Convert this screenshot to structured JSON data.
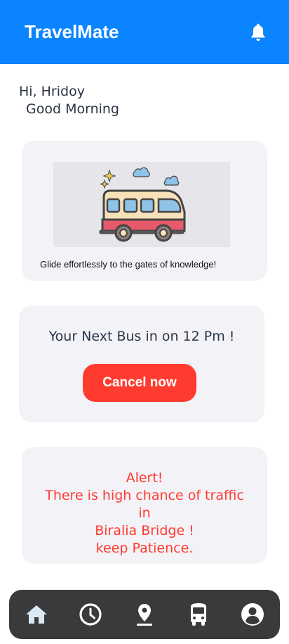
{
  "header": {
    "title": "TravelMate",
    "bell_icon": "bell-icon"
  },
  "greeting": {
    "line1": "Hi, Hridoy",
    "line2": "Good Morning"
  },
  "hero": {
    "image": "bus-illustration",
    "caption": "Glide effortlessly to the gates of knowledge!"
  },
  "next_bus": {
    "text": "Your Next Bus in on 12 Pm !",
    "cancel_label": "Cancel now"
  },
  "alert": {
    "lines": [
      "Alert!",
      "There is high chance of traffic",
      "in",
      "Biralia Bridge !",
      "keep Patience."
    ]
  },
  "tabbar": {
    "items": [
      {
        "icon": "home-icon",
        "active": true
      },
      {
        "icon": "clock-icon",
        "active": false
      },
      {
        "icon": "location-pin-icon",
        "active": false
      },
      {
        "icon": "bus-icon",
        "active": false
      },
      {
        "icon": "account-icon",
        "active": false
      }
    ]
  },
  "colors": {
    "primary": "#0a84ff",
    "danger": "#ff3b30",
    "card": "#f2f2f7",
    "tabbar": "#3a3a3c",
    "active_tab": "#dbe9f7"
  }
}
